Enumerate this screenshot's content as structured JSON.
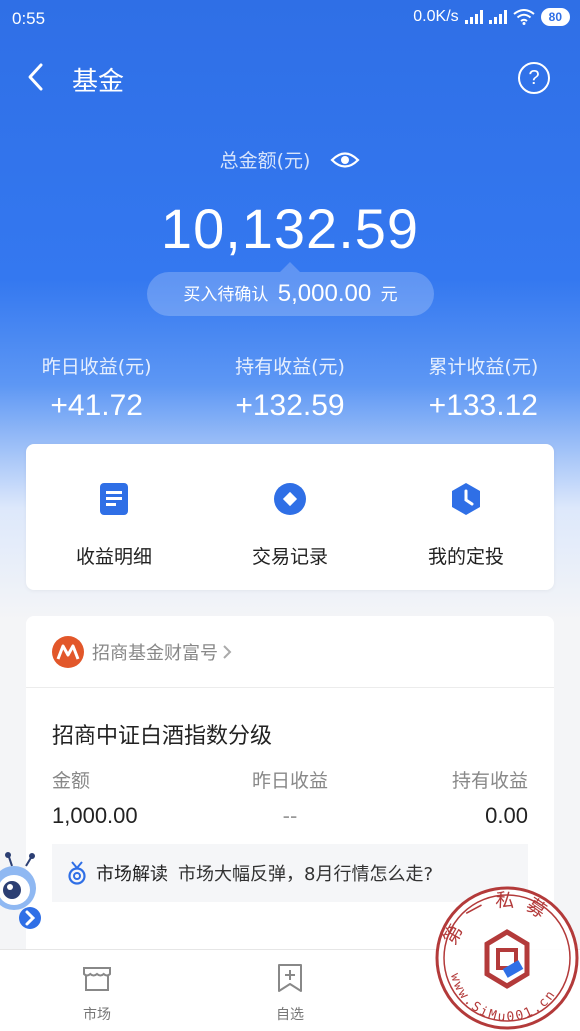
{
  "status_bar": {
    "time": "0:55",
    "net_speed": "0.0K/s",
    "battery": "80"
  },
  "navbar": {
    "title": "基金",
    "back_icon": "chevron-left-icon",
    "help_label": "?"
  },
  "summary": {
    "total_label": "总金额(元)",
    "total_amount": "10,132.59",
    "pending_label": "买入待确认",
    "pending_amount": "5,000.00",
    "pending_unit": "元"
  },
  "stats": [
    {
      "label": "昨日收益(元)",
      "value": "+41.72"
    },
    {
      "label": "持有收益(元)",
      "value": "+132.59"
    },
    {
      "label": "累计收益(元)",
      "value": "+133.12"
    }
  ],
  "actions": [
    {
      "label": "收益明细",
      "icon": "document-icon"
    },
    {
      "label": "交易记录",
      "icon": "record-icon"
    },
    {
      "label": "我的定投",
      "icon": "clock-icon"
    }
  ],
  "fund_card": {
    "provider": "招商基金财富号",
    "fund_name": "招商中证白酒指数分级",
    "columns": [
      {
        "label": "金额",
        "value": "1,000.00"
      },
      {
        "label": "昨日收益",
        "value": "--"
      },
      {
        "label": "持有收益",
        "value": "0.00"
      }
    ],
    "insight_tag": "市场解读",
    "insight_text": "市场大幅反弹，8月行情怎么走?"
  },
  "tabbar": [
    {
      "label": "市场",
      "icon": "market-icon"
    },
    {
      "label": "自选",
      "icon": "add-favorite-icon"
    }
  ],
  "watermark": {
    "text": "第一私募",
    "url": "www.SiMu001.cn"
  },
  "colors": {
    "primary": "#3478f0",
    "accent_orange": "#e2572a"
  }
}
